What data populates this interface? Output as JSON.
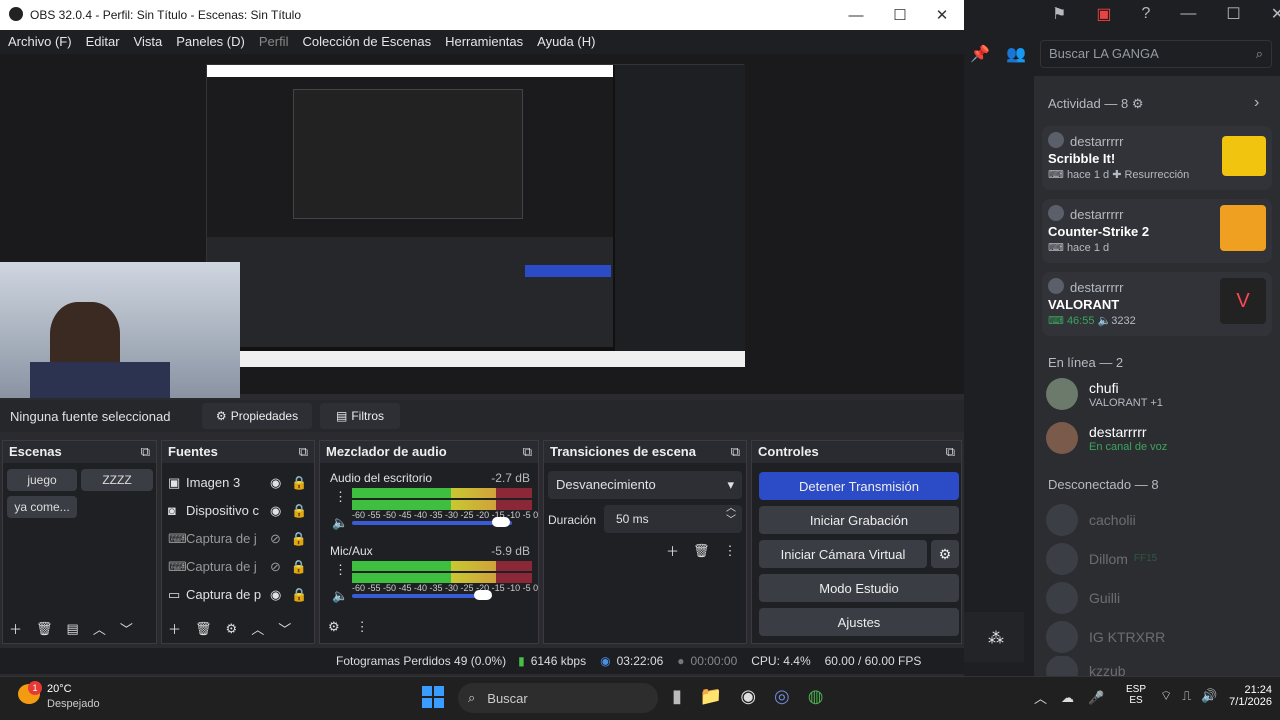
{
  "window": {
    "title": "OBS 32.0.4 - Perfil: Sin Título - Escenas: Sin Título",
    "min": "—",
    "max": "☐",
    "close": "✕"
  },
  "menu": [
    "Archivo (F)",
    "Editar",
    "Vista",
    "Paneles (D)",
    "Perfil",
    "Colección de Escenas",
    "Herramientas",
    "Ayuda (H)"
  ],
  "source_bar": {
    "none_selected": "Ninguna fuente seleccionad",
    "properties": "Propiedades",
    "filters": "Filtros"
  },
  "scenes": {
    "title": "Escenas",
    "items": [
      "juego",
      "ZZZZ",
      "ya come..."
    ]
  },
  "sources": {
    "title": "Fuentes",
    "items": [
      "Imagen 3",
      "Dispositivo c",
      "Captura de j",
      "Captura de j",
      "Captura de p"
    ]
  },
  "mixer": {
    "title": "Mezclador de audio",
    "channels": [
      {
        "name": "Audio del escritorio",
        "db": "-2.7 dB"
      },
      {
        "name": "Mic/Aux",
        "db": "-5.9 dB"
      }
    ],
    "scale": "-60 -55 -50 -45 -40 -35 -30 -25 -20 -15 -10 -5 0"
  },
  "transitions": {
    "title": "Transiciones de escena",
    "selected": "Desvanecimiento",
    "duration_label": "Duración",
    "duration": "50 ms"
  },
  "controls": {
    "title": "Controles",
    "stop_stream": "Detener Transmisión",
    "start_record": "Iniciar Grabación",
    "virtual_cam": "Iniciar Cámara Virtual",
    "studio": "Modo Estudio",
    "settings": "Ajustes"
  },
  "status": {
    "dropped": "Fotogramas Perdidos 49 (0.0%)",
    "kbps": "6146 kbps",
    "stream_time": "03:22:06",
    "rec_time": "00:00:00",
    "cpu": "CPU: 4.4%",
    "fps": "60.00 / 60.00 FPS"
  },
  "discord": {
    "search": "Buscar LA GANGA",
    "activity_header": "Actividad — 8",
    "activities": [
      {
        "user": "destarrrrr",
        "game": "Scribble It!",
        "meta": "hace 1 d",
        "extra": "Resurrección"
      },
      {
        "user": "destarrrrr",
        "game": "Counter-Strike 2",
        "meta": "hace 1 d",
        "extra": ""
      },
      {
        "user": "destarrrrr",
        "game": "VALORANT",
        "meta": "46:55",
        "extra": "3232"
      }
    ],
    "online_header": "En línea — 2",
    "online": [
      {
        "name": "chufi",
        "status": "VALORANT +1"
      },
      {
        "name": "destarrrrr",
        "status": "En canal de voz"
      }
    ],
    "offline_header": "Desconectado — 8",
    "offline": [
      "cacholii",
      "Dillom",
      "Guilli",
      "IG KTRXRR",
      "kzzub"
    ],
    "offline_badge": "FF15"
  },
  "taskbar": {
    "temp": "20°C",
    "weather": "Despejado",
    "search": "Buscar",
    "lang1": "ESP",
    "lang2": "ES",
    "time": "21:24",
    "date": "7/1/2026",
    "badge": "1"
  }
}
